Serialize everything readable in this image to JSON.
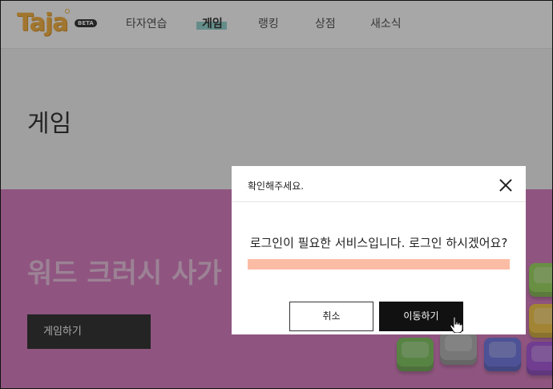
{
  "header": {
    "logo": "Taja",
    "badge": "BETA",
    "nav": [
      {
        "label": "타자연습"
      },
      {
        "label": "게임"
      },
      {
        "label": "랭킹"
      },
      {
        "label": "상점"
      },
      {
        "label": "새소식"
      }
    ],
    "active_nav": "게임",
    "accent_color": "#70c8c2",
    "logo_color": "#f5a623"
  },
  "page": {
    "title": "게임"
  },
  "hero": {
    "title": "워드 크러시 사가",
    "play_label": "게임하기",
    "background_color": "#d46ab8"
  },
  "modal": {
    "title": "확인해주세요.",
    "message": "로그인이 필요한 서비스입니다. 로그인 하시겠어요?",
    "cancel_label": "취소",
    "confirm_label": "이동하기",
    "close_icon": "close-icon"
  }
}
